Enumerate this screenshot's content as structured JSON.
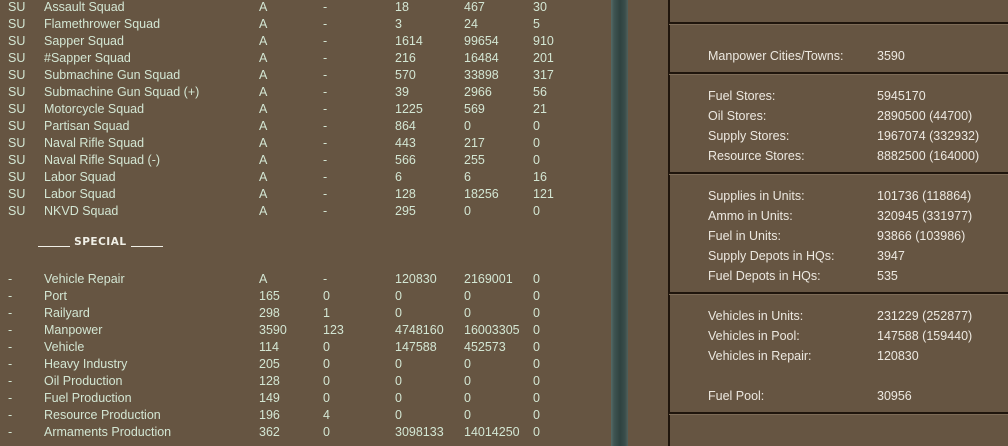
{
  "units": [
    [
      "SU",
      "Assault Squad",
      "A",
      "-",
      "18",
      "467",
      "30"
    ],
    [
      "SU",
      "Flamethrower Squad",
      "A",
      "-",
      "3",
      "24",
      "5"
    ],
    [
      "SU",
      "Sapper Squad",
      "A",
      "-",
      "1614",
      "99654",
      "910"
    ],
    [
      "SU",
      "#Sapper Squad",
      "A",
      "-",
      "216",
      "16484",
      "201"
    ],
    [
      "SU",
      "Submachine Gun Squad",
      "A",
      "-",
      "570",
      "33898",
      "317"
    ],
    [
      "SU",
      "Submachine Gun Squad (+)",
      "A",
      "-",
      "39",
      "2966",
      "56"
    ],
    [
      "SU",
      "Motorcycle Squad",
      "A",
      "-",
      "1225",
      "569",
      "21"
    ],
    [
      "SU",
      "Partisan Squad",
      "A",
      "-",
      "864",
      "0",
      "0"
    ],
    [
      "SU",
      "Naval Rifle Squad",
      "A",
      "-",
      "443",
      "217",
      "0"
    ],
    [
      "SU",
      "Naval Rifle Squad (-)",
      "A",
      "-",
      "566",
      "255",
      "0"
    ],
    [
      "SU",
      "Labor Squad",
      "A",
      "-",
      "6",
      "6",
      "16"
    ],
    [
      "SU",
      "Labor Squad",
      "A",
      "-",
      "128",
      "18256",
      "121"
    ],
    [
      "SU",
      "NKVD Squad",
      "A",
      "-",
      "295",
      "0",
      "0"
    ]
  ],
  "special_title": "SPECIAL",
  "special": [
    [
      "-",
      "Vehicle Repair",
      "A",
      "-",
      "120830",
      "2169001",
      "0"
    ],
    [
      "-",
      "Port",
      "165",
      "0",
      "0",
      "0",
      "0"
    ],
    [
      "-",
      "Railyard",
      "298",
      "1",
      "0",
      "0",
      "0"
    ],
    [
      "-",
      "Manpower",
      "3590",
      "123",
      "4748160",
      "16003305",
      "0"
    ],
    [
      "-",
      "Vehicle",
      "114",
      "0",
      "147588",
      "452573",
      "0"
    ],
    [
      "-",
      "Heavy Industry",
      "205",
      "0",
      "0",
      "0",
      "0"
    ],
    [
      "-",
      "Oil Production",
      "128",
      "0",
      "0",
      "0",
      "0"
    ],
    [
      "-",
      "Fuel Production",
      "149",
      "0",
      "0",
      "0",
      "0"
    ],
    [
      "-",
      "Resource Production",
      "196",
      "4",
      "0",
      "0",
      "0"
    ],
    [
      "-",
      "Armaments Production",
      "362",
      "0",
      "3098133",
      "14014250",
      "0"
    ]
  ],
  "stats": [
    {
      "label": "Manpower Cities/Towns:",
      "value": "3590"
    },
    {
      "label": "Fuel Stores:",
      "value": "5945170"
    },
    {
      "label": "Oil Stores:",
      "value": "2890500 (44700)"
    },
    {
      "label": "Supply Stores:",
      "value": "1967074 (332932)"
    },
    {
      "label": "Resource Stores:",
      "value": "8882500 (164000)"
    },
    {
      "label": "Supplies in Units:",
      "value": "101736 (118864)"
    },
    {
      "label": "Ammo in Units:",
      "value": "320945 (331977)"
    },
    {
      "label": "Fuel in Units:",
      "value": "93866 (103986)"
    },
    {
      "label": "Supply Depots in HQs:",
      "value": "3947"
    },
    {
      "label": "Fuel Depots in HQs:",
      "value": "535"
    },
    {
      "label": "Vehicles in Units:",
      "value": "231229 (252877)"
    },
    {
      "label": "Vehicles in Pool:",
      "value": "147588 (159440)"
    },
    {
      "label": "Vehicles in Repair:",
      "value": "120830"
    },
    {
      "label": "Fuel Pool:",
      "value": "30956"
    }
  ]
}
